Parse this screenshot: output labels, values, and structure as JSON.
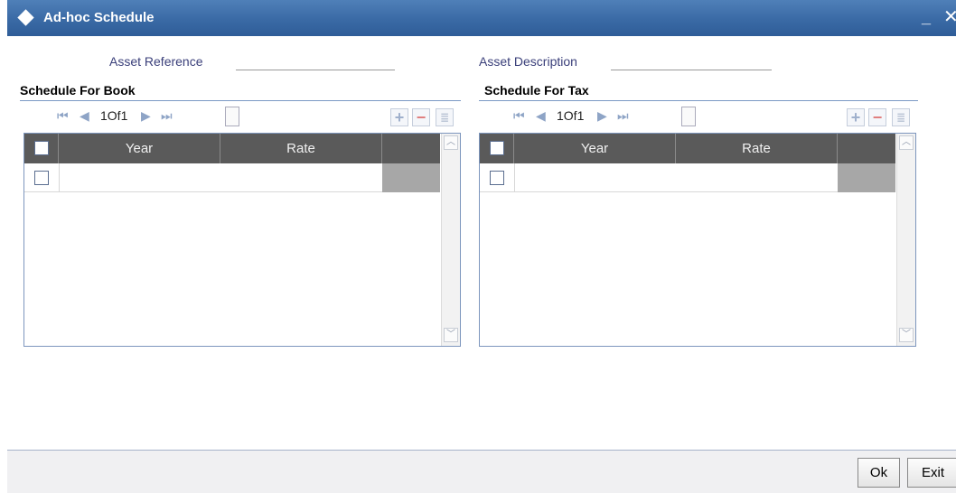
{
  "window": {
    "title": "Ad-hoc Schedule",
    "minimize_glyph": "_",
    "close_glyph": "✕"
  },
  "form": {
    "asset_reference": {
      "label": "Asset Reference",
      "value": ""
    },
    "asset_description": {
      "label": "Asset Description",
      "value": ""
    }
  },
  "book": {
    "title": "Schedule For Book",
    "pager": {
      "first": "⏮",
      "prev": "◀",
      "info": "1Of1",
      "next": "▶",
      "last": "⏭"
    },
    "toolbar": {
      "add": "+",
      "remove": "−",
      "view": "≣"
    },
    "columns": [
      "Year",
      "Rate"
    ],
    "rows": [
      {
        "year": "",
        "rate": ""
      }
    ]
  },
  "tax": {
    "title": "Schedule For Tax",
    "pager": {
      "first": "⏮",
      "prev": "◀",
      "info": "1Of1",
      "next": "▶",
      "last": "⏭"
    },
    "toolbar": {
      "add": "+",
      "remove": "−",
      "view": "≣"
    },
    "columns": [
      "Year",
      "Rate"
    ],
    "rows": [
      {
        "year": "",
        "rate": ""
      }
    ]
  },
  "footer": {
    "ok_label": "Ok",
    "exit_label": "Exit"
  },
  "scroll": {
    "up": "︿",
    "down": "﹀"
  }
}
